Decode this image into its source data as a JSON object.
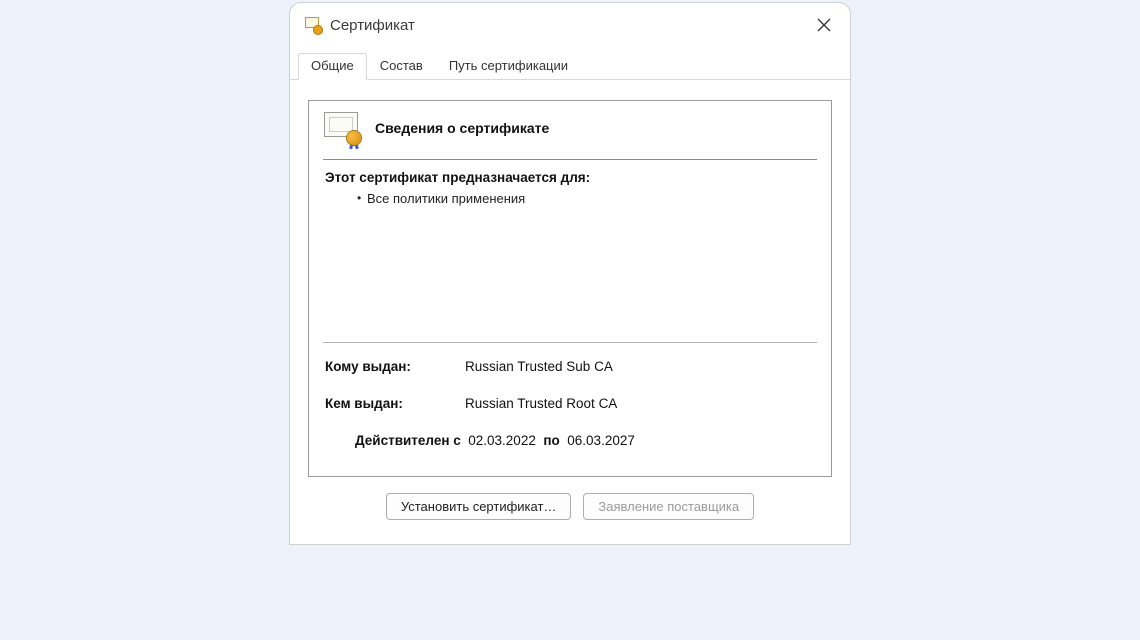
{
  "window": {
    "title": "Сертификат"
  },
  "tabs": {
    "general": "Общие",
    "details": "Состав",
    "path": "Путь сертификации"
  },
  "info": {
    "heading": "Сведения о сертификате",
    "purpose_heading": "Этот сертификат предназначается для:",
    "purpose_item": "Все политики применения",
    "issued_to_label": "Кому выдан:",
    "issued_to_value": "Russian Trusted Sub CA",
    "issued_by_label": "Кем выдан:",
    "issued_by_value": "Russian Trusted Root CA",
    "valid_from_label": "Действителен c",
    "valid_from_value": "02.03.2022",
    "valid_to_label": "по",
    "valid_to_value": "06.03.2027"
  },
  "buttons": {
    "install": "Установить сертификат…",
    "statement": "Заявление поставщика"
  }
}
